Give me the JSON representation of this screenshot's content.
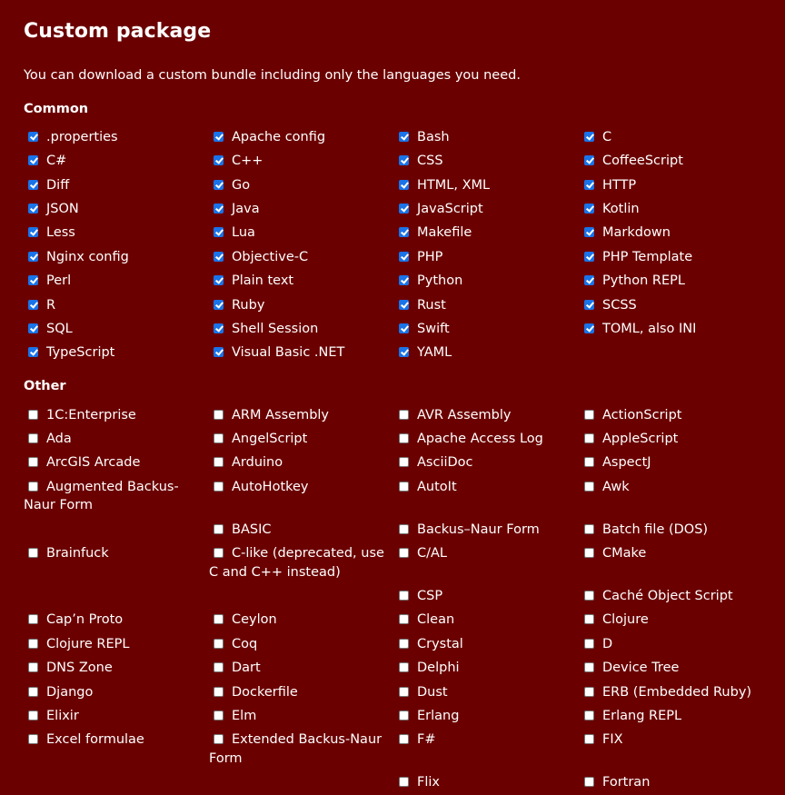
{
  "title": "Custom package",
  "intro": "You can download a custom bundle including only the languages you need.",
  "sections": [
    {
      "heading": "Common",
      "checked": true,
      "items": [
        ".properties",
        "Apache config",
        "Bash",
        "C",
        "C#",
        "C++",
        "CSS",
        "CoffeeScript",
        "Diff",
        "Go",
        "HTML, XML",
        "HTTP",
        "JSON",
        "Java",
        "JavaScript",
        "Kotlin",
        "Less",
        "Lua",
        "Makefile",
        "Markdown",
        "Nginx config",
        "Objective-C",
        "PHP",
        "PHP Template",
        "Perl",
        "Plain text",
        "Python",
        "Python REPL",
        "R",
        "Ruby",
        "Rust",
        "SCSS",
        "SQL",
        "Shell Session",
        "Swift",
        "TOML, also INI",
        "TypeScript",
        "Visual Basic .NET",
        "YAML"
      ]
    },
    {
      "heading": "Other",
      "checked": false,
      "items": [
        "1C:Enterprise",
        "ARM Assembly",
        "AVR Assembly",
        "ActionScript",
        "Ada",
        "AngelScript",
        "Apache Access Log",
        "AppleScript",
        "ArcGIS Arcade",
        "Arduino",
        "AsciiDoc",
        "AspectJ",
        "Augmented Backus-Naur Form",
        "AutoHotkey",
        "AutoIt",
        "Awk",
        "",
        "BASIC",
        "Backus–Naur Form",
        "Batch file (DOS)",
        "Brainfuck",
        "C-like (deprecated, use C and C++ instead)",
        "C/AL",
        "CMake",
        "",
        "",
        "CSP",
        "Caché Object Script",
        "Cap’n Proto",
        "Ceylon",
        "Clean",
        "Clojure",
        "Clojure REPL",
        "Coq",
        "Crystal",
        "D",
        "DNS Zone",
        "Dart",
        "Delphi",
        "Device Tree",
        "Django",
        "Dockerfile",
        "Dust",
        "ERB (Embedded Ruby)",
        "Elixir",
        "Elm",
        "Erlang",
        "Erlang REPL",
        "Excel formulae",
        "Extended Backus-Naur Form",
        "F#",
        "FIX",
        "",
        "",
        "Flix",
        "Fortran"
      ]
    }
  ]
}
